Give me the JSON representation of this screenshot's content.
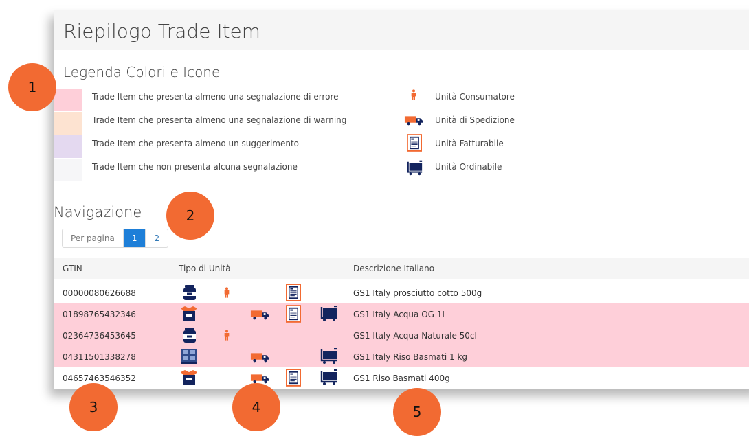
{
  "page_title": "Riepilogo Trade Item",
  "legend": {
    "title": "Legenda Colori e Icone",
    "colors": [
      {
        "label": "Trade Item che presenta almeno una segnalazione di errore",
        "color": "#fecfd9"
      },
      {
        "label": "Trade Item che presenta almeno una segnalazione di warning",
        "color": "#fde3d1"
      },
      {
        "label": "Trade Item che presenta almeno un suggerimento",
        "color": "#e4d9f0"
      },
      {
        "label": "Trade Item che non presenta alcuna segnalazione",
        "color": "#f6f6f8"
      }
    ],
    "icons": [
      {
        "label": "Unità Consumatore",
        "icon": "person-icon"
      },
      {
        "label": "Unità di Spedizione",
        "icon": "truck-icon"
      },
      {
        "label": "Unità Fatturabile",
        "icon": "invoice-icon"
      },
      {
        "label": "Unità Ordinabile",
        "icon": "cart-icon"
      }
    ]
  },
  "navigation": {
    "title": "Navigazione",
    "per_page_label": "Per pagina",
    "pages": [
      "1",
      "2"
    ],
    "active_page": "1"
  },
  "table": {
    "headers": {
      "gtin": "GTIN",
      "unit_type": "Tipo di Unità",
      "description": "Descrizione Italiano"
    },
    "rows": [
      {
        "gtin": "00000080626688",
        "description": "GS1 Italy prosciutto cotto 500g",
        "status": "none",
        "product_icon": "jar-icon",
        "consumer": true,
        "shipping": false,
        "invoice": true,
        "order": false
      },
      {
        "gtin": "01898765432346",
        "description": "GS1 Italy Acqua OG 1L",
        "status": "error",
        "product_icon": "open-box-icon",
        "consumer": false,
        "shipping": true,
        "invoice": true,
        "order": true
      },
      {
        "gtin": "02364736453645",
        "description": "GS1 Italy Acqua Naturale 50cl",
        "status": "error",
        "product_icon": "jar-icon",
        "consumer": true,
        "shipping": false,
        "invoice": false,
        "order": false
      },
      {
        "gtin": "04311501338278",
        "description": "GS1 Italy Riso Basmati 1 kg",
        "status": "error",
        "product_icon": "pallet-icon",
        "consumer": false,
        "shipping": true,
        "invoice": false,
        "order": true
      },
      {
        "gtin": "04657463546352",
        "description": "GS1 Riso Basmati 400g",
        "status": "none",
        "product_icon": "open-box-icon",
        "consumer": false,
        "shipping": true,
        "invoice": true,
        "order": true
      }
    ]
  },
  "badges": [
    "1",
    "2",
    "3",
    "4",
    "5"
  ],
  "colors": {
    "accent": "#f26a32",
    "navy": "#13245e",
    "primary": "#1e7fd8",
    "error_row": "#fecfd9"
  }
}
